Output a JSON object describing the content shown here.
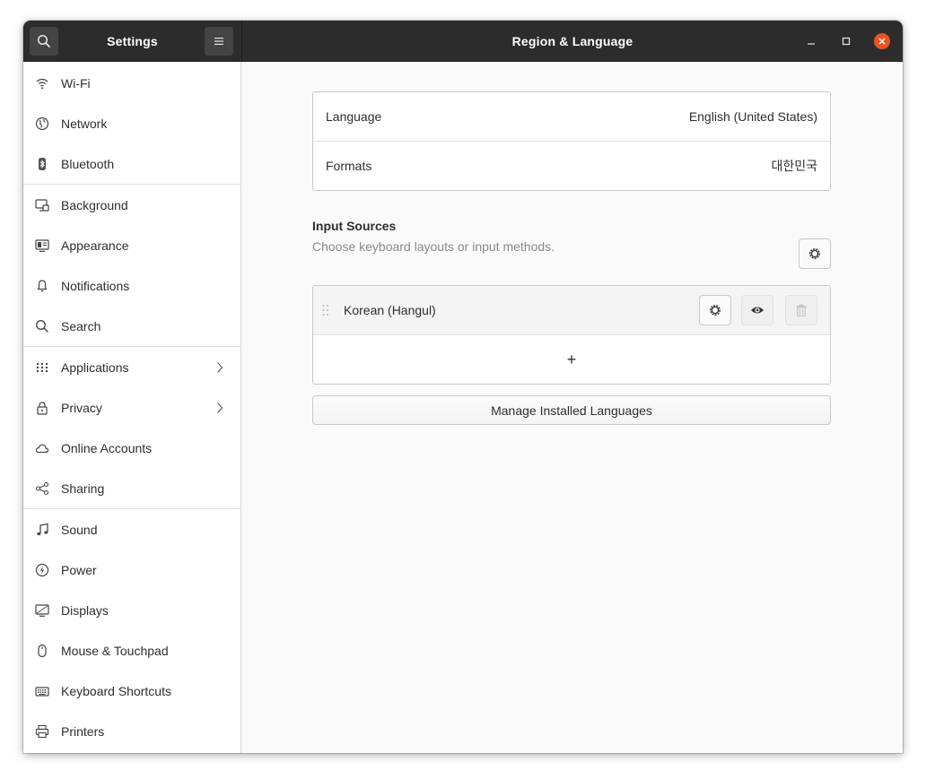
{
  "header": {
    "sidebar_title": "Settings",
    "title": "Region & Language",
    "search_icon": "search-icon",
    "menu_icon": "hamburger-icon"
  },
  "sidebar": {
    "items": [
      {
        "label": "Wi-Fi",
        "icon": "wifi-icon"
      },
      {
        "label": "Network",
        "icon": "network-icon"
      },
      {
        "label": "Bluetooth",
        "icon": "bluetooth-icon"
      },
      {
        "label": "Background",
        "icon": "background-icon"
      },
      {
        "label": "Appearance",
        "icon": "appearance-icon"
      },
      {
        "label": "Notifications",
        "icon": "bell-icon"
      },
      {
        "label": "Search",
        "icon": "search-icon"
      },
      {
        "label": "Applications",
        "icon": "grid-icon"
      },
      {
        "label": "Privacy",
        "icon": "lock-icon"
      },
      {
        "label": "Online Accounts",
        "icon": "cloud-icon"
      },
      {
        "label": "Sharing",
        "icon": "share-icon"
      },
      {
        "label": "Sound",
        "icon": "music-note-icon"
      },
      {
        "label": "Power",
        "icon": "power-icon"
      },
      {
        "label": "Displays",
        "icon": "display-icon"
      },
      {
        "label": "Mouse & Touchpad",
        "icon": "mouse-icon"
      },
      {
        "label": "Keyboard Shortcuts",
        "icon": "keyboard-icon"
      },
      {
        "label": "Printers",
        "icon": "printer-icon"
      }
    ]
  },
  "main": {
    "language": {
      "label": "Language",
      "value": "English (United States)"
    },
    "formats": {
      "label": "Formats",
      "value": "대한민국"
    },
    "input_sources": {
      "title": "Input Sources",
      "subtitle": "Choose keyboard layouts or input methods.",
      "items": [
        {
          "label": "Korean (Hangul)"
        }
      ],
      "add_label": "+"
    },
    "manage_label": "Manage Installed Languages"
  },
  "colors": {
    "accent": "#e95420",
    "headerbar": "#2c2c2c"
  }
}
